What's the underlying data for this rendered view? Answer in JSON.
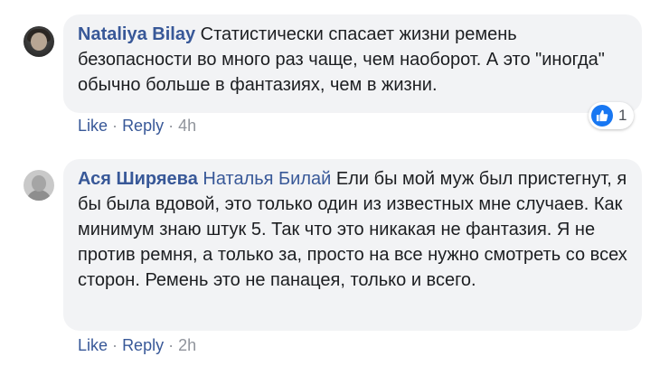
{
  "comments": [
    {
      "author": "Nataliya Bilay",
      "text": "Статистически спасает жизни ремень безопасности во много раз чаще, чем наоборот. А это \"иногда\" обычно больше в фантазиях, чем в жизни.",
      "like_label": "Like",
      "reply_label": "Reply",
      "separator": "·",
      "time": "4h",
      "reaction_icon": "like-thumb-icon",
      "reaction_count": "1"
    },
    {
      "author": "Ася Ширяева",
      "mention": "Наталья Билай",
      "text": "Ели бы мой муж был пристегнут, я бы была вдовой, это только один из известных мне случаев. Как минимум знаю штук 5. Так что это никакая не фантазия. Я не против ремня, а только за, просто на все нужно смотреть со всех сторон. Ремень это не панацея, только и всего.",
      "like_label": "Like",
      "reply_label": "Reply",
      "separator": "·",
      "time": "2h"
    }
  ],
  "colors": {
    "link": "#385898",
    "bubble": "#f2f3f5",
    "meta": "#90949c",
    "like_blue": "#1877f2"
  }
}
